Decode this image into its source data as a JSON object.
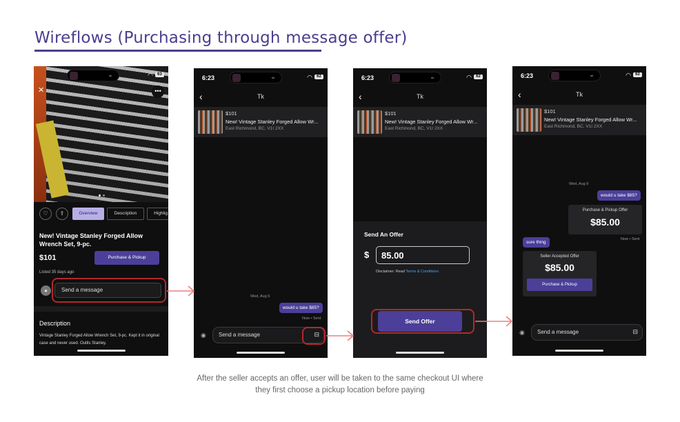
{
  "heading": "Wireflows (Purchasing through message offer)",
  "caption_line1": "After the seller accepts an offer, user will be taken to the same checkout UI where",
  "caption_line2": "they first choose a pickup location before paying",
  "screen1": {
    "battery": "63",
    "tabs": [
      "Overview",
      "Description",
      "Highlig"
    ],
    "title": "New! Vintage Stanley Forged Allow Wrench Set, 9-pc.",
    "price": "$101",
    "purchase_label": "Purchase & Pickup",
    "listed": "Listed 35 days ago",
    "message_placeholder": "Send a message",
    "description_heading": "Description",
    "description_text": "Vintage Stanley Forged Allow Wrench Set, 9-pc. Kept it in original case and never used. Outils Stanley."
  },
  "screen2": {
    "time": "6:23",
    "battery": "62",
    "contact": "Tk",
    "listing_price": "$101",
    "listing_title": "New! Vintage Stanley Forged Allow Wr...",
    "listing_location": "East Richmond, BC, V1I 2XX",
    "date": "Wed, Aug 9",
    "outgoing_message": "would u take $85?",
    "sent_status": "Now • Sent",
    "message_placeholder": "Send a message"
  },
  "screen3": {
    "time": "6:23",
    "battery": "62",
    "contact": "Tk",
    "listing_price": "$101",
    "listing_title": "New! Vintage Stanley Forged Allow Wr...",
    "listing_location": "East Richmond, BC, V1I 2XX",
    "sheet_title": "Send An Offer",
    "currency": "$",
    "offer_amount": "85.00",
    "disclaimer_prefix": "Disclaimer: Read ",
    "disclaimer_link": "Terms & Conditions",
    "send_offer_label": "Send Offer"
  },
  "screen4": {
    "time": "6:23",
    "battery": "62",
    "contact": "Tk",
    "listing_price": "$101",
    "listing_title": "New! Vintage Stanley Forged Allow Wr...",
    "listing_location": "East Richmond, BC, V1I 2XX",
    "date": "Wed, Aug 9",
    "outgoing_message": "would u take $85?",
    "offer_card_title": "Purchase & Pickup Offer",
    "offer_card_amount": "$85.00",
    "sent_status": "Now • Sent",
    "incoming_message": "sure thing",
    "accepted_title": "Seller Accepted Offer",
    "accepted_amount": "$85.00",
    "accepted_button": "Purchase & Pickup",
    "message_placeholder": "Send a message"
  },
  "colors": {
    "accent": "#4b3f99",
    "highlight": "#b3282d",
    "arrow": "#ef7f7f",
    "heading": "#4a3e8f"
  }
}
